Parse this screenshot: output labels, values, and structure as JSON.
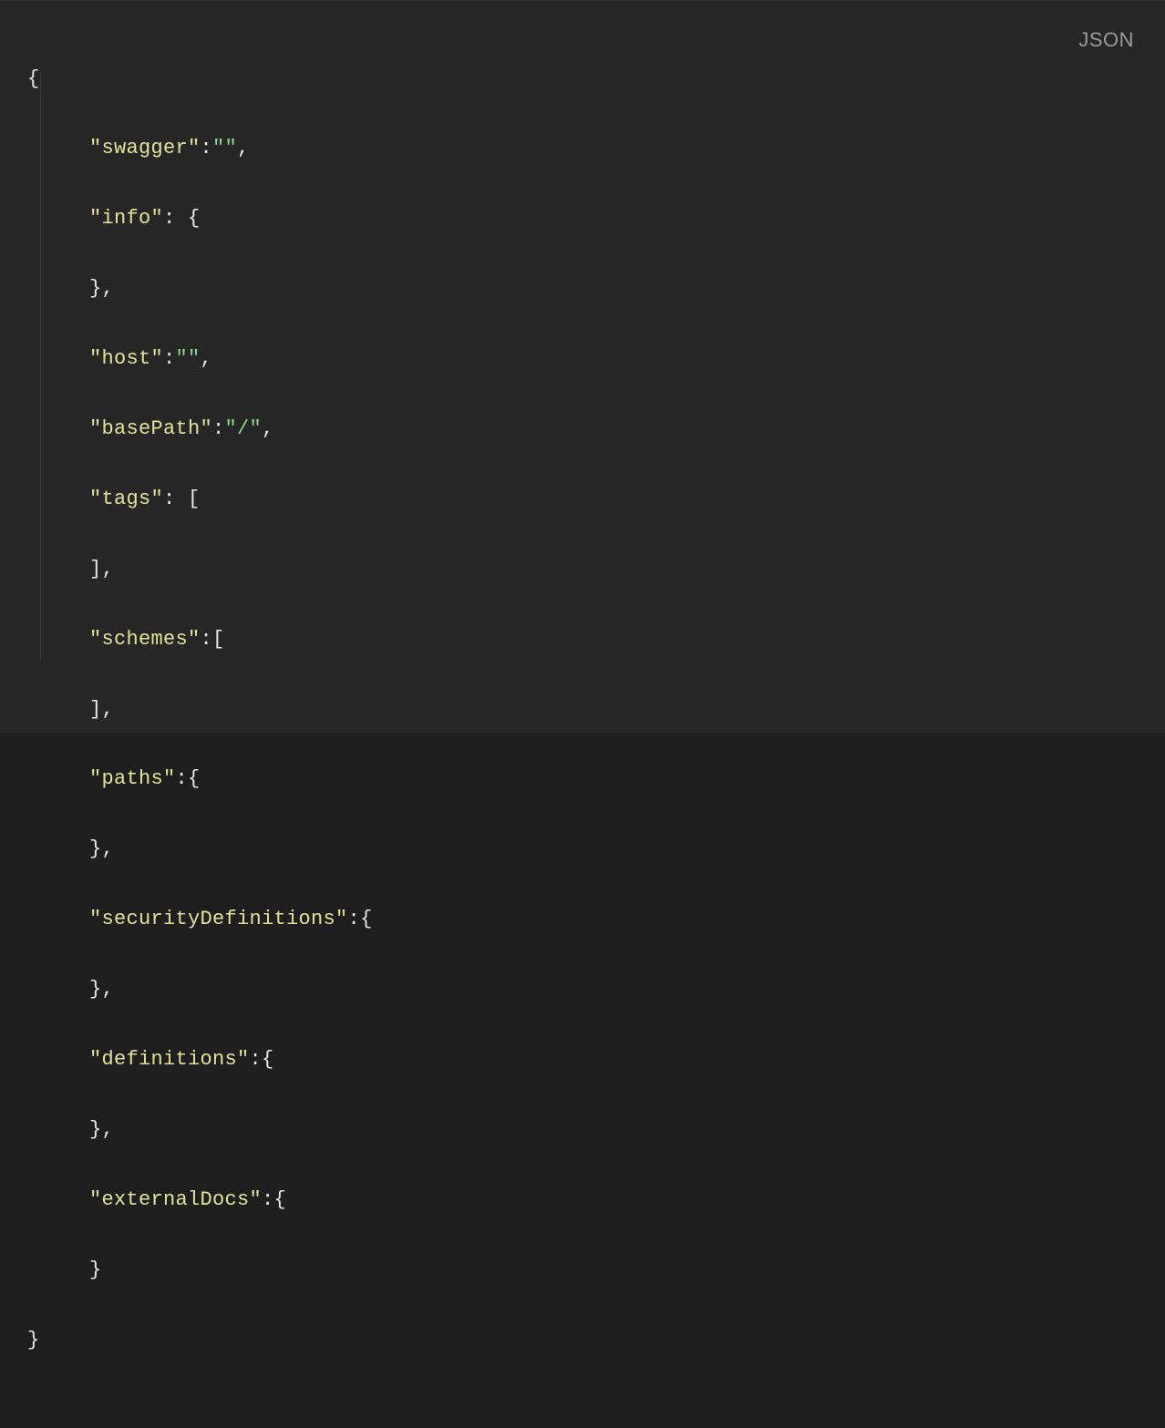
{
  "language_badge": "JSON",
  "code": {
    "line1": {
      "text": "{"
    },
    "line2": {
      "key": "\"swagger\"",
      "colon": ":",
      "value": "\"\"",
      "trail": ","
    },
    "line3": {
      "key": "\"info\"",
      "colon": ": ",
      "value": "{"
    },
    "line4": {
      "text": "},"
    },
    "line5": {
      "key": "\"host\"",
      "colon": ":",
      "value": "\"\"",
      "trail": ","
    },
    "line6": {
      "key": "\"basePath\"",
      "colon": ":",
      "value": "\"/\"",
      "trail": ","
    },
    "line7": {
      "key": "\"tags\"",
      "colon": ": ",
      "value": "["
    },
    "line8": {
      "text": "],"
    },
    "line9": {
      "key": "\"schemes\"",
      "colon": ":",
      "value": "["
    },
    "line10": {
      "text": "],"
    },
    "line11": {
      "key": "\"paths\"",
      "colon": ":",
      "value": "{"
    },
    "line12": {
      "text": "},"
    },
    "line13": {
      "key": "\"securityDefinitions\"",
      "colon": ":",
      "value": "{"
    },
    "line14": {
      "text": "},"
    },
    "line15": {
      "key": "\"definitions\"",
      "colon": ":",
      "value": "{"
    },
    "line16": {
      "text": "},"
    },
    "line17": {
      "key": "\"externalDocs\"",
      "colon": ":",
      "value": "{"
    },
    "line18": {
      "text": "}"
    },
    "line19": {
      "text": "}"
    }
  }
}
